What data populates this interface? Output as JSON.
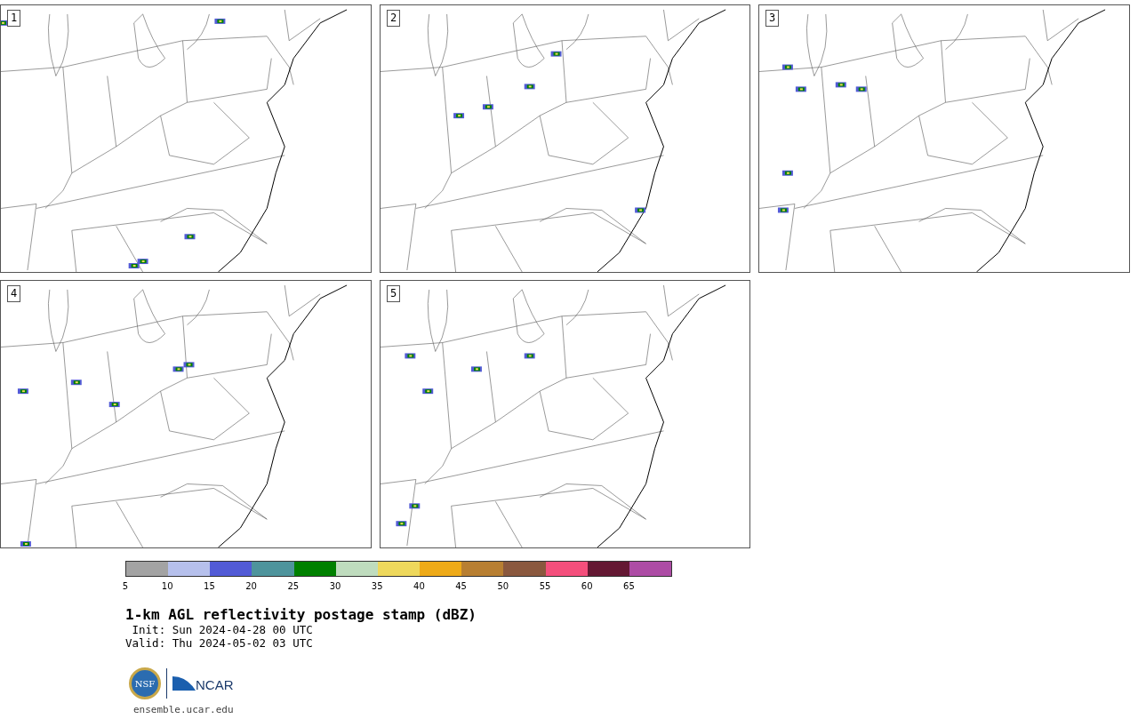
{
  "panels": [
    {
      "label": "1"
    },
    {
      "label": "2"
    },
    {
      "label": "3"
    },
    {
      "label": "4"
    },
    {
      "label": "5"
    }
  ],
  "colorbar": {
    "segments": [
      {
        "color": "#a3a3a3"
      },
      {
        "color": "#b6c0ec"
      },
      {
        "color": "#525bd6"
      },
      {
        "color": "#4e949c"
      },
      {
        "color": "#008000"
      },
      {
        "color": "#bfdcbe"
      },
      {
        "color": "#eed85c"
      },
      {
        "color": "#eeaa18"
      },
      {
        "color": "#b87f32"
      },
      {
        "color": "#8a583e"
      },
      {
        "color": "#f44f7c"
      },
      {
        "color": "#641833"
      },
      {
        "color": "#ad4ca5"
      }
    ],
    "ticks": [
      "5",
      "10",
      "15",
      "20",
      "25",
      "30",
      "35",
      "40",
      "45",
      "50",
      "55",
      "60",
      "65"
    ]
  },
  "title": "1-km AGL reflectivity postage stamp (dBZ)",
  "init": " Init: Sun 2024-04-28 00 UTC",
  "valid": "Valid: Thu 2024-05-02 03 UTC",
  "logos": {
    "nsf": "NSF",
    "ncar": "NCAR"
  },
  "footer": "ensemble.ucar.edu"
}
